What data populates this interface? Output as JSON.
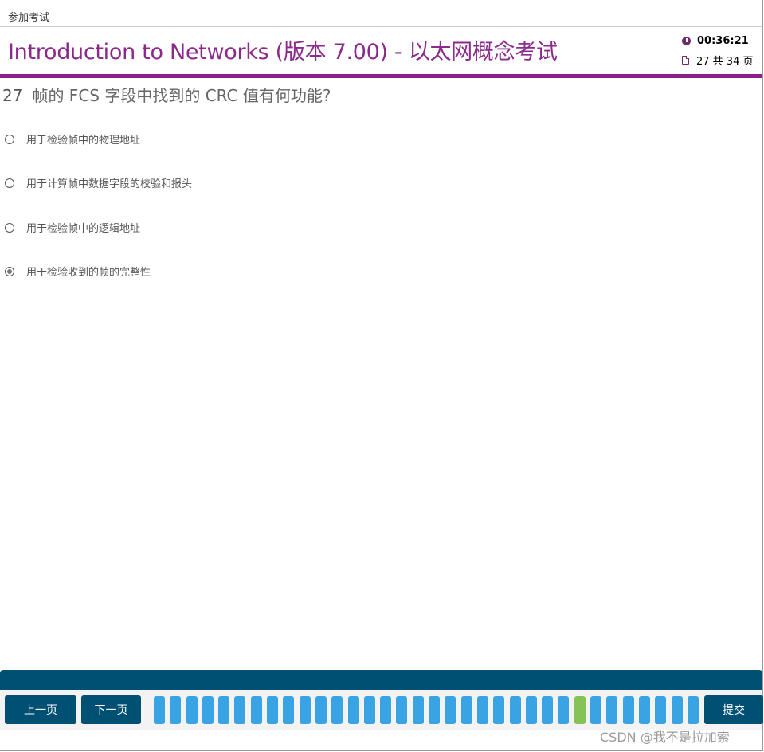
{
  "topbar": {
    "title": "参加考试"
  },
  "header": {
    "exam_title_en": "Introduction to Networks (版本 7.00)",
    "exam_title_sep": " - ",
    "exam_title_cn": "以太网概念考试",
    "timer": "00:36:21",
    "page_indicator": "27 共 34 页"
  },
  "question": {
    "number": "27",
    "text": "帧的 FCS 字段中找到的 CRC 值有何功能?",
    "options": [
      {
        "label": "用于检验帧中的物理地址",
        "selected": false
      },
      {
        "label": "用于计算帧中数据字段的校验和报头",
        "selected": false
      },
      {
        "label": "用于检验帧中的逻辑地址",
        "selected": false
      },
      {
        "label": "用于检验收到的帧的完整性",
        "selected": true
      }
    ]
  },
  "footer": {
    "prev_label": "上一页",
    "next_label": "下一页",
    "submit_label": "提交",
    "question_count": 34,
    "current_question": 27
  },
  "watermark": "CSDN @我不是拉加索",
  "colors": {
    "accent": "#8b1f86",
    "nav": "#005073",
    "qbox": "#3aa3e3",
    "qbox_current": "#85c356"
  }
}
